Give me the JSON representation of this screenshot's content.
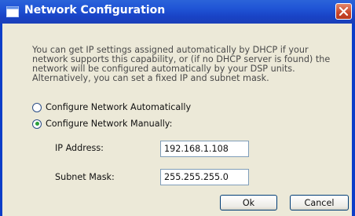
{
  "window": {
    "title": "Network Configuration"
  },
  "description": "You can get IP settings assigned automatically by DHCP if your network supports this capability, or (if no DHCP server is found) the network will be configured automatically by your DSP units. Alternatively, you can set a fixed IP and subnet mask.",
  "options": {
    "auto_label": "Configure Network Automatically",
    "manual_label": "Configure Network Manually:",
    "selected": "manual"
  },
  "fields": {
    "ip_label": "IP Address:",
    "ip_value": "192.168.1.108",
    "mask_label": "Subnet Mask:",
    "mask_value": "255.255.255.0"
  },
  "buttons": {
    "ok": "Ok",
    "cancel": "Cancel"
  },
  "colors": {
    "titlebar": "#2055d6",
    "dialog_bg": "#ece9d8",
    "close": "#c9452a"
  },
  "icons": {
    "title": "window-icon",
    "close": "close-icon"
  }
}
